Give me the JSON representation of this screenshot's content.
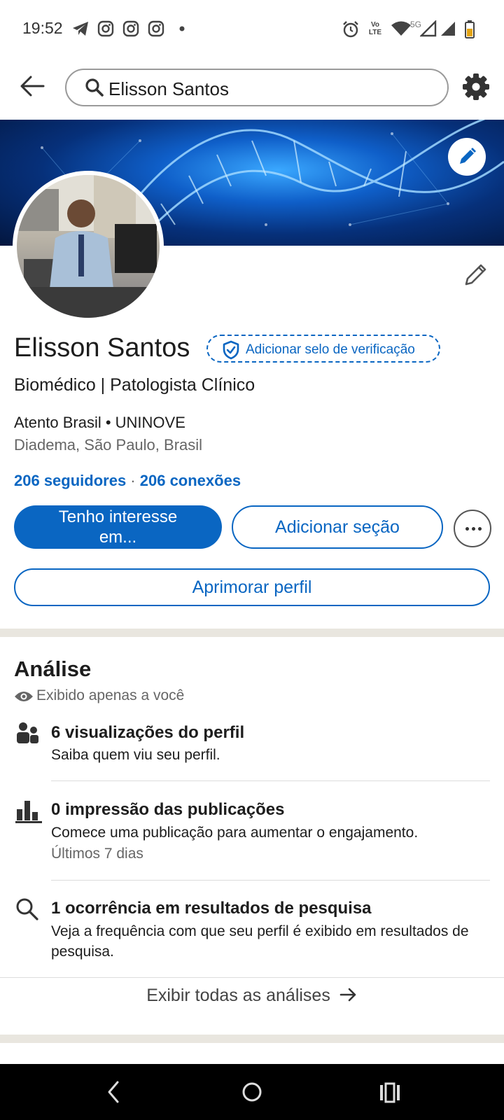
{
  "status_bar": {
    "time": "19:52",
    "network_label": "5G",
    "volte_top": "Vo",
    "volte_bottom": "LTE",
    "icons": [
      "telegram-icon",
      "instagram-icon",
      "instagram-icon",
      "instagram-icon",
      "dot-icon",
      "alarm-icon",
      "volte-icon",
      "wifi-icon",
      "signal-icon",
      "signal-icon",
      "battery-icon"
    ]
  },
  "search": {
    "value": "Elisson Santos"
  },
  "profile": {
    "name": "Elisson Santos",
    "verify_label": "Adicionar selo de verificação",
    "headline": "Biomédico | Patologista Clínico",
    "company": "Atento Brasil • UNINOVE",
    "location": "Diadema, São Paulo, Brasil",
    "followers": "206 seguidores",
    "separator": " · ",
    "connections": "206 conexões"
  },
  "actions": {
    "interest_line1": "Tenho interesse",
    "interest_line2": "em...",
    "add_section": "Adicionar seção",
    "improve": "Aprimorar perfil"
  },
  "analytics": {
    "title": "Análise",
    "visibility": "Exibido apenas a você",
    "items": [
      {
        "icon": "people-icon",
        "title": "6 visualizações do perfil",
        "text": "Saiba quem viu seu perfil."
      },
      {
        "icon": "bar-chart-icon",
        "title": "0 impressão das publicações",
        "text": "Comece uma publicação para aumentar o engajamento.",
        "muted": "Últimos 7 dias"
      },
      {
        "icon": "search-icon",
        "title": "1 ocorrência em resultados de pesquisa",
        "text": "Veja a frequência com que seu perfil é exibido em resultados de pesquisa."
      }
    ],
    "show_all": "Exibir todas as análises"
  },
  "colors": {
    "accent": "#0a66c2",
    "divider": "#e9e6df",
    "navbar": "#000000"
  }
}
